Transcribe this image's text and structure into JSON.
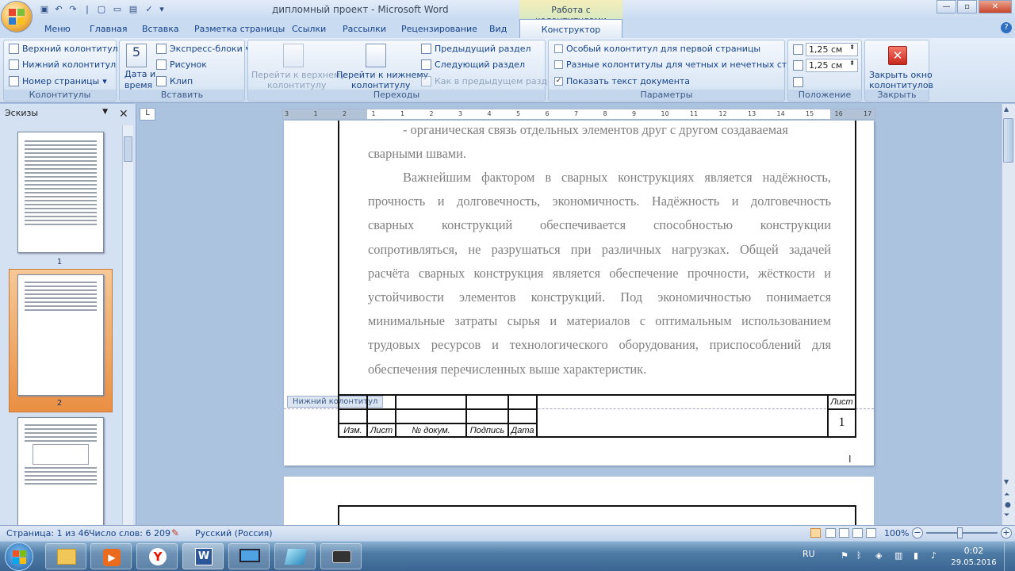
{
  "window": {
    "title": "дипломный проект - Microsoft Word",
    "context_title": "Работа с колонтитулами",
    "min": "—",
    "max": "▫",
    "close": "✕"
  },
  "tabs": [
    "Меню",
    "Главная",
    "Вставка",
    "Разметка страницы",
    "Ссылки",
    "Рассылки",
    "Рецензирование",
    "Вид"
  ],
  "active_tab": "Конструктор",
  "help": "?",
  "ribbon": {
    "groups": {
      "kolontituly": "Колонтитулы",
      "vstavit": "Вставить",
      "perehody": "Переходы",
      "parametry": "Параметры",
      "polozhenie": "Положение",
      "zakryt": "Закрыть"
    },
    "header_btn": "Верхний колонтитул",
    "footer_btn": "Нижний колонтитул",
    "pagenum_btn": "Номер страницы",
    "date_btn_1": "Дата и",
    "date_btn_2": "время",
    "express_btn": "Экспресс-блоки",
    "picture_btn": "Рисунок",
    "clip_btn": "Клип",
    "goto_header_1": "Перейти к верхнему",
    "goto_header_2": "колонтитулу",
    "goto_footer_1": "Перейти к нижнему",
    "goto_footer_2": "колонтитулу",
    "prev_section": "Предыдущий раздел",
    "next_section": "Следующий раздел",
    "link_prev": "Как в предыдущем разделе",
    "first_page": "Особый колонтитул для первой страницы",
    "odd_even": "Разные колонтитулы для четных и нечетных страниц",
    "show_text": "Показать текст документа",
    "header_pos": "1,25 см",
    "footer_pos": "1,25 см",
    "close_1": "Закрыть окно",
    "close_2": "колонтитулов"
  },
  "side": {
    "title": "Эскизы",
    "thumb_labels": [
      "1",
      "2"
    ]
  },
  "ruler": {
    "marks": [
      "3",
      "1",
      "2",
      "1",
      "1",
      "2",
      "3",
      "4",
      "5",
      "6",
      "7",
      "8",
      "9",
      "10",
      "11",
      "12",
      "13",
      "14",
      "15",
      "16",
      "17"
    ]
  },
  "doc": {
    "p1": "- органическая связь отдельных элементов друг с другом создаваемая",
    "p1b": "сварными швами.",
    "p2_lines": [
      "Важнейшим фактором в сварных конструкциях является надёжность,",
      "прочность и долговечность, экономичность. Надёжность и долговечность",
      "сварных конструкций обеспечивается способностью конструкции",
      "сопротивляться, не разрушаться при различных нагрузках. Общей задачей",
      "расчёта сварных конструкция является обеспечение прочности, жёсткости и",
      "устойчивости элементов конструкций. Под экономичностью понимается",
      "минимальные затраты сырья и материалов с оптимальным использованием",
      "трудовых ресурсов и технологического оборудования, приспособлений для",
      "обеспечения перечисленных выше характеристик."
    ],
    "footer_tag": "Нижний колонтитул",
    "stamp": {
      "izm": "Изм.",
      "list": "Лист",
      "ndokum": "№ докум.",
      "podpis": "Подпись",
      "data": "Дата",
      "list_label": "Лист",
      "page_number": "1"
    }
  },
  "status": {
    "page": "Страница: 1 из 46",
    "words": "Число слов: 6 209",
    "lang": "Русский (Россия)",
    "zoom": "100%"
  },
  "tray": {
    "lang": "RU",
    "time": "0:02",
    "date": "29.05.2016"
  }
}
